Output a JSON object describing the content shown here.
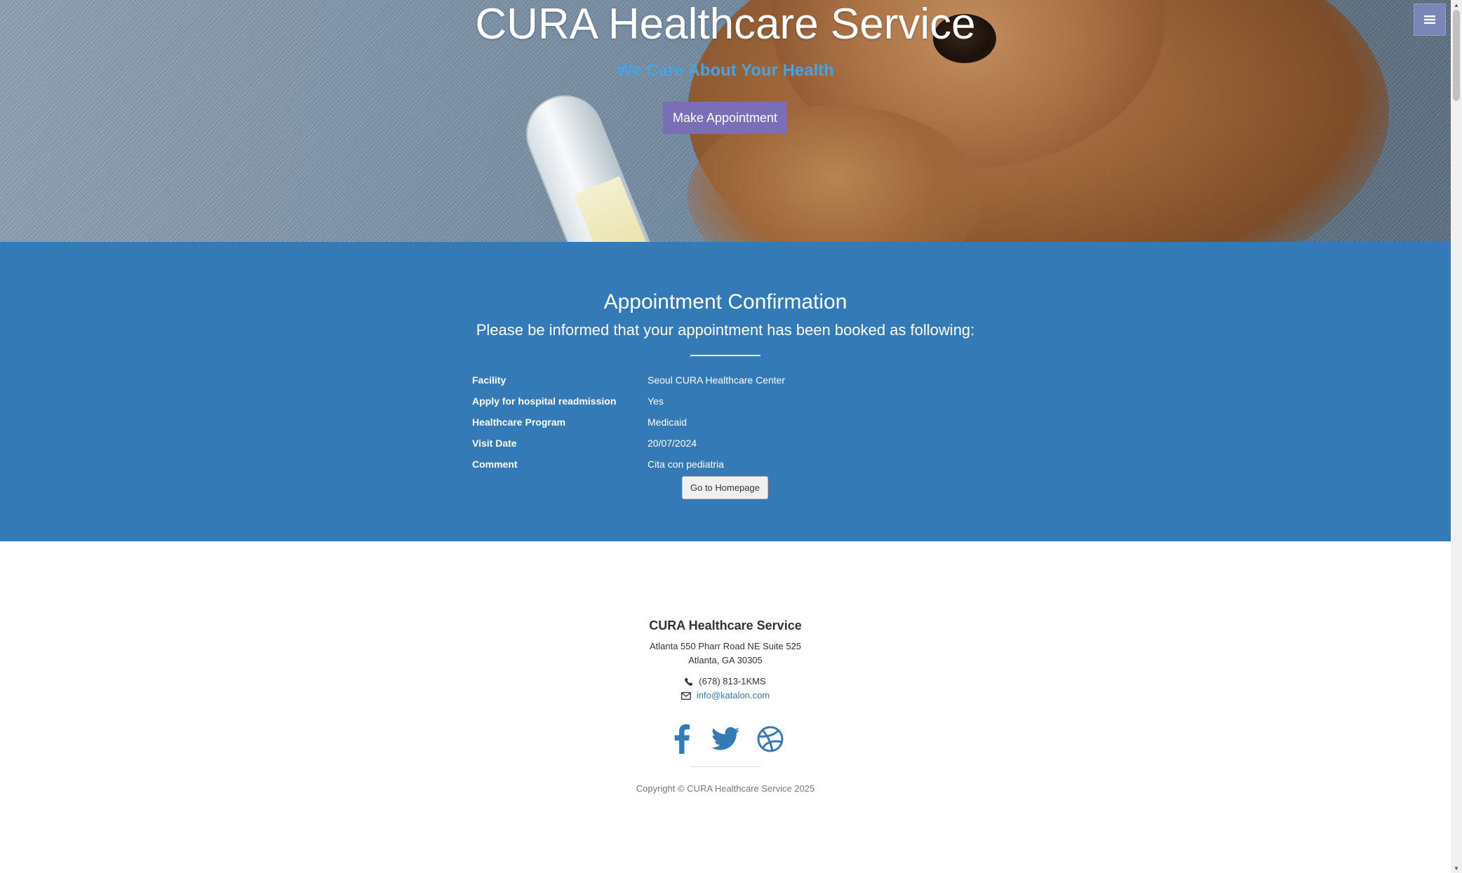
{
  "header": {
    "title": "CURA Healthcare Service",
    "subtitle": "We Care About Your Health",
    "make_appointment_label": "Make Appointment",
    "menu_icon": "hamburger-menu-icon"
  },
  "confirmation": {
    "title": "Appointment Confirmation",
    "lead": "Please be informed that your appointment has been booked as following:",
    "details": [
      {
        "label": "Facility",
        "value": "Seoul CURA Healthcare Center"
      },
      {
        "label": "Apply for hospital readmission",
        "value": "Yes"
      },
      {
        "label": "Healthcare Program",
        "value": "Medicaid"
      },
      {
        "label": "Visit Date",
        "value": "20/07/2024"
      },
      {
        "label": "Comment",
        "value": "Cita con pediatria"
      }
    ],
    "homepage_label": "Go to Homepage"
  },
  "footer": {
    "title": "CURA Healthcare Service",
    "address_line1": "Atlanta 550 Pharr Road NE Suite 525",
    "address_line2": "Atlanta, GA 30305",
    "phone": "(678) 813-1KMS",
    "email": "info@katalon.com",
    "social_icons": [
      "facebook-icon",
      "twitter-icon",
      "dribbble-icon"
    ],
    "copyright": "Copyright © CURA Healthcare Service 2025"
  },
  "colors": {
    "section_blue": "#337ab7",
    "button_purple": "#7a6eb7",
    "subtitle_blue": "#4aa3e0",
    "menu_button": "#7b86b8"
  }
}
